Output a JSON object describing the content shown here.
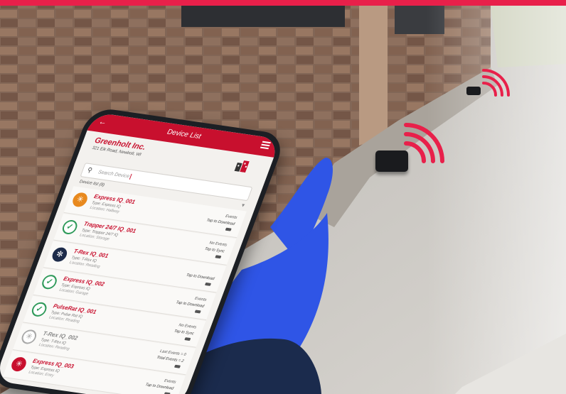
{
  "colors": {
    "brand_red": "#c8102e",
    "accent_pink": "#e8204a",
    "glove_blue": "#2f55e6",
    "status_ok": "#2f9a5a",
    "status_warn": "#e8891e",
    "status_sleep": "#1d2b4a",
    "status_off": "#a9a9a9"
  },
  "app": {
    "header_title": "Device List",
    "company_name": "Greenholt Inc.",
    "company_address": "321 Elk Road, Newbolt, WI",
    "search_placeholder": "Search Device",
    "list_label": "Device list (8)",
    "icons": {
      "back": "back-arrow-icon",
      "menu": "hamburger-menu-icon",
      "building": "building-icon",
      "search": "search-icon",
      "filter": "filter-icon"
    }
  },
  "devices": [
    {
      "name": "Express IQ_001",
      "type": "Type: Express IQ",
      "location": "Location: Hallway",
      "events": "Events",
      "action": "Tap to Download",
      "status": "warn"
    },
    {
      "name": "Trapper 24/7 IQ_001",
      "type": "Type: Trapper 24/7 IQ",
      "location": "Location: Storage",
      "events": "No Events",
      "action": "Tap to Sync",
      "status": "ok"
    },
    {
      "name": "T-Rex IQ_001",
      "type": "Type: T-Rex IQ",
      "location": "Location: Reading",
      "events": "",
      "action": "Tap to Download",
      "status": "sleep"
    },
    {
      "name": "Express IQ_002",
      "type": "Type: Express IQ",
      "location": "Location: Garage",
      "events": "Events",
      "action": "Tap to Download",
      "status": "ok"
    },
    {
      "name": "PulseRat IQ_001",
      "type": "Type: Pulse Rat IQ",
      "location": "Location: Reading",
      "events": "No Events",
      "action": "Tap to Sync",
      "status": "ok"
    },
    {
      "name": "T-Rex IQ_002",
      "type": "Type: T-Rex IQ",
      "location": "Location: Reading",
      "events": "Last Events = 0",
      "action": "Total Events = 2",
      "status": "off"
    },
    {
      "name": "Express IQ_003",
      "type": "Type: Express IQ",
      "location": "Location: Entry",
      "events": "Events",
      "action": "Tap to Download",
      "status": "alert"
    }
  ]
}
